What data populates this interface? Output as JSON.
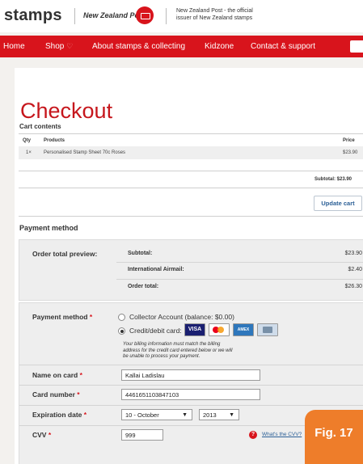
{
  "header": {
    "site_logo": "stamps",
    "partner_logo": "New Zealand Post",
    "tagline_line1": "New Zealand Post - the official",
    "tagline_line2": "issuer of New Zealand stamps"
  },
  "nav": {
    "items": [
      "Home",
      "Shop",
      "About stamps & collecting",
      "Kidzone",
      "Contact & support"
    ],
    "shop_icon": "heart-icon",
    "accent_color": "#d8141c"
  },
  "page_title": "Checkout",
  "cart": {
    "heading": "Cart contents",
    "columns": {
      "qty": "Qty",
      "products": "Products",
      "price": "Price"
    },
    "rows": [
      {
        "qty": "1×",
        "product": "Personalised Stamp Sheet 70c Roses",
        "price": "$23.90"
      }
    ],
    "subtotal": "Subtotal: $23.90",
    "update_button": "Update cart"
  },
  "payment": {
    "section_title": "Payment method",
    "order_total_label": "Order total preview:",
    "summary": [
      {
        "label": "Subtotal:",
        "value": "$23.90"
      },
      {
        "label": "International Airmail:",
        "value": "$2.40"
      },
      {
        "label": "Order total:",
        "value": "$26.30"
      }
    ],
    "method_label": "Payment method",
    "required_marker": "*",
    "options": [
      {
        "label": "Collector Account (balance: $0.00)",
        "selected": false
      },
      {
        "label": "Credit/debit card:",
        "selected": true
      }
    ],
    "card_logos": [
      "VISA",
      "mastercard",
      "AMEX",
      "card"
    ],
    "billing_note_line1": "Your billing information must match the billing",
    "billing_note_line2": "address for the credit card entered below or we will",
    "billing_note_line3": "be unable to process your payment.",
    "name_label": "Name on card",
    "name_value": "Kallai Ladislau",
    "number_label": "Card number",
    "number_value": "4461651103847103",
    "expiry_label": "Expiration date",
    "expiry_month": "10 - October",
    "expiry_year": "2013",
    "cvv_label": "CVV",
    "cvv_value": "999",
    "cvv_help_link": "What's the CVV?"
  },
  "figure_badge": "Fig. 17"
}
